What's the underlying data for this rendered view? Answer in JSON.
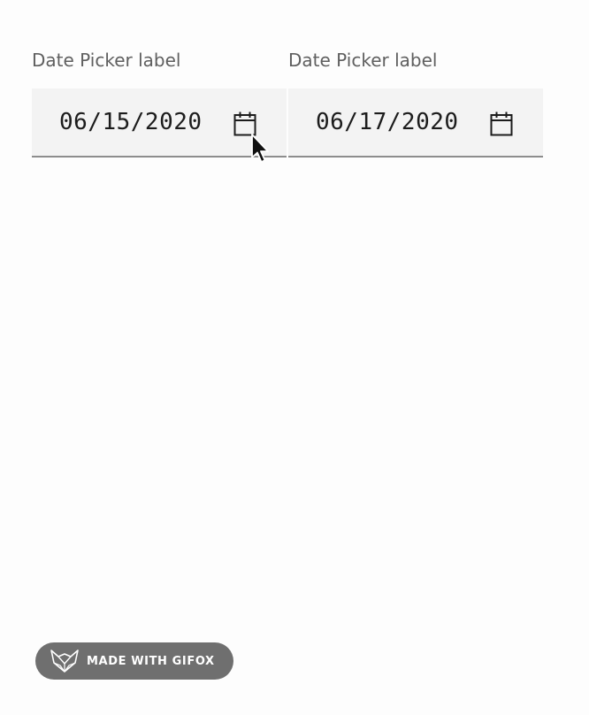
{
  "date_pickers": [
    {
      "label": "Date Picker label",
      "value": "06/15/2020",
      "icon": "calendar-icon"
    },
    {
      "label": "Date Picker label",
      "value": "06/17/2020",
      "icon": "calendar-icon"
    }
  ],
  "watermark": {
    "text": "MADE WITH GIFOX",
    "icon": "gifox-logo-icon"
  },
  "colors": {
    "background": "#fdfdfd",
    "field_background": "#f3f3f3",
    "field_border": "#8d8d8d",
    "label": "#5f5f5f",
    "value": "#1c1c1c",
    "badge": "#6f6f6f"
  }
}
